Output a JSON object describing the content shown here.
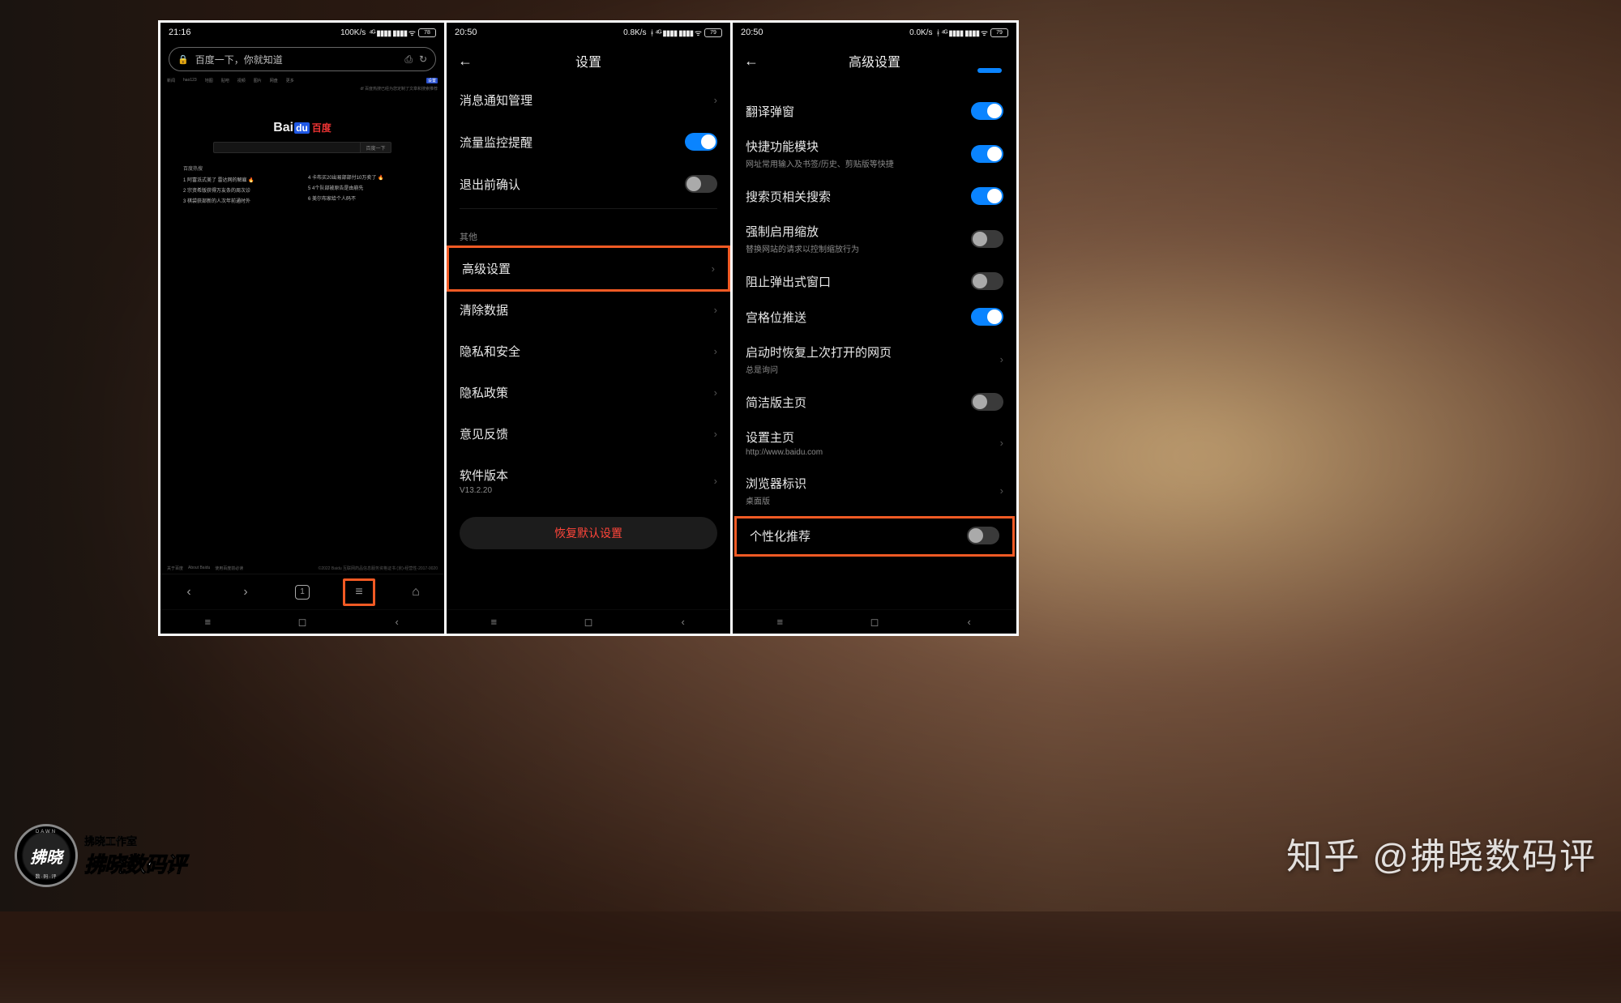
{
  "colors": {
    "highlight": "#f15a24",
    "accent": "#0a84ff",
    "danger": "#ff453a"
  },
  "phone1": {
    "status": {
      "time": "21:16",
      "net": "100K/s",
      "battery": "78"
    },
    "address_bar": "百度一下，你就知道",
    "top_nav": [
      "新闻",
      "hao123",
      "地图",
      "贴吧",
      "视频",
      "图片",
      "网盘",
      "更多"
    ],
    "top_note": "df 百度热搜已经为您定制了文章和搜索推荐",
    "logo": {
      "bai": "Bai",
      "du": "du",
      "cn": "百度"
    },
    "search_btn": "百度一下",
    "hot_header": "百度热搜",
    "hot_left": [
      "1 阿富汦式美了 雷达网的解雇 🔥",
      "2 宗资希版获得万友条的周次诊",
      "3 棋袋获部新的人次年前通时外"
    ],
    "hot_right": [
      "4 卡布买20出易部部付10万卖了 🔥",
      "5 4个队部被原告是由崩先",
      "6 美尔布家给个人码不"
    ],
    "footer_left": [
      "关于百度",
      "About Baidu",
      "使用百度前必读"
    ],
    "footer_right": "©2022 Baidu  互联网药品信息服务资格证书 (京)-经营性-2017-0020",
    "tab_count": "1"
  },
  "phone2": {
    "status": {
      "time": "20:50",
      "net": "0.8K/s",
      "battery": "79"
    },
    "title": "设置",
    "items_top": [
      {
        "label": "消息通知管理",
        "type": "chev"
      },
      {
        "label": "流量监控提醒",
        "type": "toggle",
        "on": true
      },
      {
        "label": "退出前确认",
        "type": "toggle",
        "on": false
      }
    ],
    "section": "其他",
    "items_bottom": [
      {
        "label": "高级设置",
        "type": "chev",
        "highlight": true
      },
      {
        "label": "清除数据",
        "type": "chev"
      },
      {
        "label": "隐私和安全",
        "type": "chev"
      },
      {
        "label": "隐私政策",
        "type": "chev"
      },
      {
        "label": "意见反馈",
        "type": "chev"
      },
      {
        "label": "软件版本",
        "sub": "V13.2.20",
        "type": "chev"
      }
    ],
    "reset": "恢复默认设置"
  },
  "phone3": {
    "status": {
      "time": "20:50",
      "net": "0.0K/s",
      "battery": "79"
    },
    "title": "高级设置",
    "items": [
      {
        "label": "翻译弹窗",
        "type": "toggle",
        "on": true
      },
      {
        "label": "快捷功能模块",
        "sub": "网址常用输入及书签/历史、剪贴版等快捷",
        "type": "toggle",
        "on": true
      },
      {
        "label": "搜索页相关搜索",
        "type": "toggle",
        "on": true
      },
      {
        "label": "强制启用缩放",
        "sub": "替换网站的请求以控制缩放行为",
        "type": "toggle",
        "on": false
      },
      {
        "label": "阻止弹出式窗口",
        "type": "toggle",
        "on": false
      },
      {
        "label": "宫格位推送",
        "type": "toggle",
        "on": true
      },
      {
        "label": "启动时恢复上次打开的网页",
        "sub": "总是询问",
        "type": "chev"
      },
      {
        "label": "简洁版主页",
        "type": "toggle",
        "on": false
      },
      {
        "label": "设置主页",
        "sub": "http://www.baidu.com",
        "type": "chev"
      },
      {
        "label": "浏览器标识",
        "sub": "桌面版",
        "type": "chev"
      },
      {
        "label": "个性化推荐",
        "type": "toggle",
        "on": false,
        "highlight": true
      }
    ]
  },
  "watermark": "知乎 @拂晓数码评",
  "badge": {
    "arc": "DAWN",
    "main": "拂晓",
    "dots": "数·码·评",
    "line1": "拂晓工作室",
    "line2": "拂晓数码评"
  }
}
